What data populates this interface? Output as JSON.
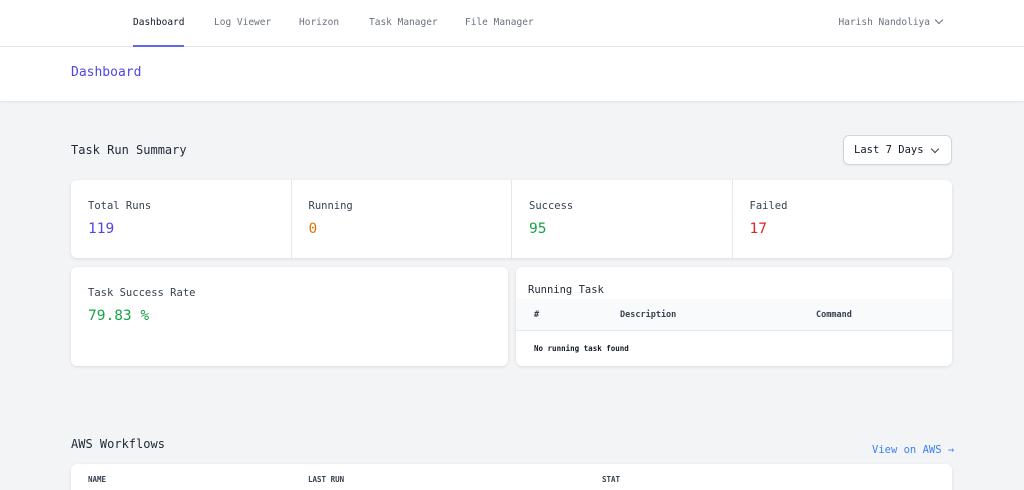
{
  "nav": {
    "links": [
      "Dashboard",
      "Log Viewer",
      "Horizon",
      "Task Manager",
      "File Manager"
    ],
    "active": "Dashboard",
    "user": "Harish Nandoliya"
  },
  "header": {
    "title": "Dashboard"
  },
  "summary": {
    "title": "Task Run Summary",
    "range": "Last 7 Days",
    "stats": [
      {
        "label": "Total Runs",
        "value": "119",
        "color": "#4f46e5"
      },
      {
        "label": "Running",
        "value": "0",
        "color": "#d97706"
      },
      {
        "label": "Success",
        "value": "95",
        "color": "#16a34a"
      },
      {
        "label": "Failed",
        "value": "17",
        "color": "#dc2626"
      }
    ]
  },
  "success_rate": {
    "label": "Task Success Rate",
    "value": "79.83 %",
    "color": "#16a34a"
  },
  "running_task": {
    "title": "Running Task",
    "columns": [
      "#",
      "Description",
      "Command"
    ],
    "empty": "No running task found"
  },
  "aws": {
    "title": "AWS Workflows",
    "view_link": "View on AWS →",
    "columns": [
      "NAME",
      "LAST RUN",
      "STAT"
    ]
  },
  "colors": {
    "accent": "#6366f1",
    "link": "#3b82f6"
  }
}
